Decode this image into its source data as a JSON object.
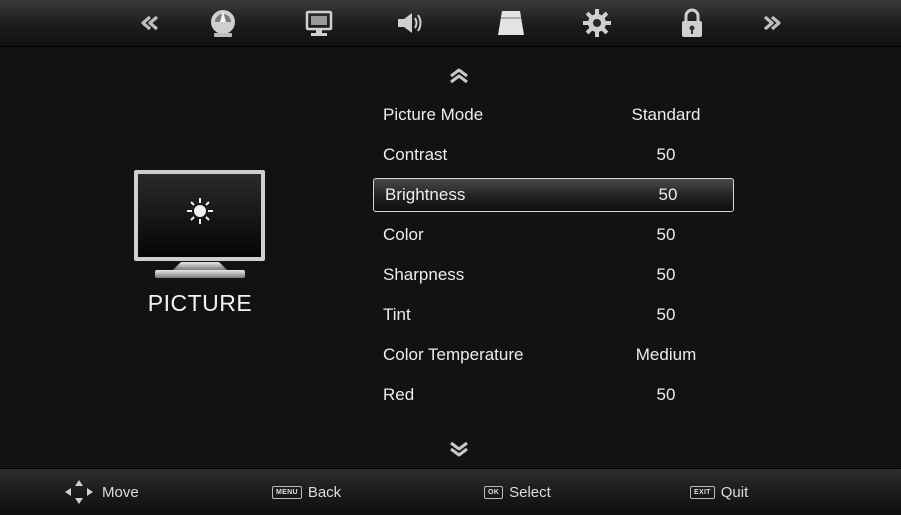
{
  "top_menu": {
    "items": [
      {
        "name": "prev-page-icon"
      },
      {
        "name": "channel-satellite-icon"
      },
      {
        "name": "picture-icon"
      },
      {
        "name": "sound-icon"
      },
      {
        "name": "picture-adjust-icon"
      },
      {
        "name": "settings-gear-icon"
      },
      {
        "name": "lock-icon"
      },
      {
        "name": "next-page-icon"
      }
    ]
  },
  "category": {
    "label": "PICTURE"
  },
  "menu": {
    "selected_index": 2,
    "rows": [
      {
        "label": "Picture Mode",
        "value": "Standard"
      },
      {
        "label": "Contrast",
        "value": "50"
      },
      {
        "label": "Brightness",
        "value": "50"
      },
      {
        "label": "Color",
        "value": "50"
      },
      {
        "label": "Sharpness",
        "value": "50"
      },
      {
        "label": "Tint",
        "value": "50"
      },
      {
        "label": "Color Temperature",
        "value": "Medium"
      },
      {
        "label": "Red",
        "value": "50"
      }
    ]
  },
  "footer": {
    "move_label": "Move",
    "back_key": "MENU",
    "back_label": "Back",
    "select_key": "OK",
    "select_label": "Select",
    "quit_key": "EXIT",
    "quit_label": "Quit"
  },
  "colors": {
    "background": "#111214",
    "text": "#ececec",
    "selection_border": "#d8d8d8"
  }
}
